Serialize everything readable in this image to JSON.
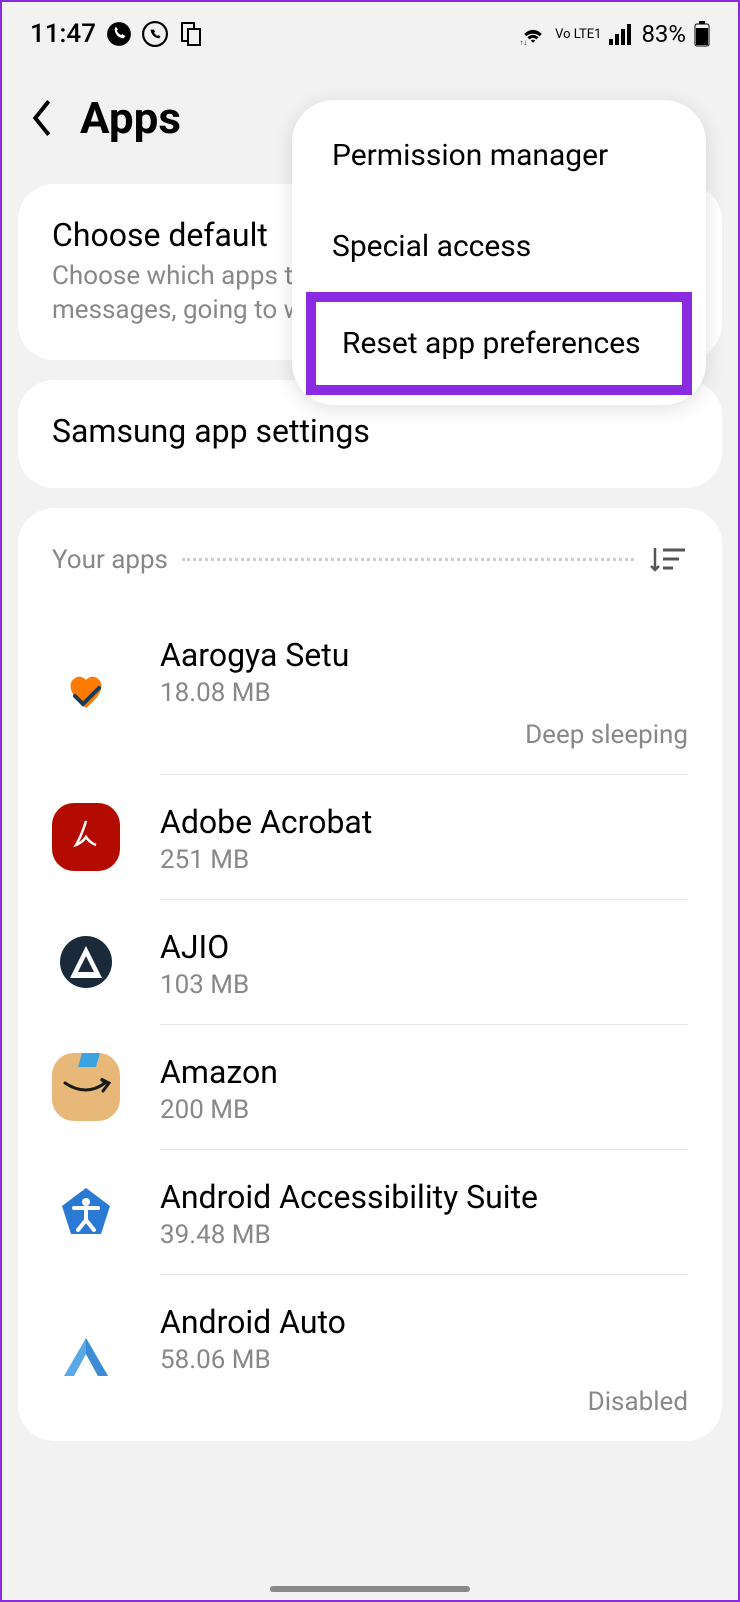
{
  "status": {
    "time": "11:47",
    "battery": "83%",
    "network": "Vo LTE1"
  },
  "header": {
    "title": "Apps"
  },
  "defaultCard": {
    "title": "Choose default",
    "subtitle": "Choose which apps to use for making calls, sending messages, going to websites, and more."
  },
  "samsungCard": {
    "title": "Samsung app settings"
  },
  "appsSection": {
    "label": "Your apps"
  },
  "apps": [
    {
      "name": "Aarogya Setu",
      "size": "18.08 MB",
      "status": "Deep sleeping"
    },
    {
      "name": "Adobe Acrobat",
      "size": "251 MB",
      "status": ""
    },
    {
      "name": "AJIO",
      "size": "103 MB",
      "status": ""
    },
    {
      "name": "Amazon",
      "size": "200 MB",
      "status": ""
    },
    {
      "name": "Android Accessibility Suite",
      "size": "39.48 MB",
      "status": ""
    },
    {
      "name": "Android Auto",
      "size": "58.06 MB",
      "status": "Disabled"
    }
  ],
  "popup": {
    "items": [
      "Permission manager",
      "Special access",
      "Reset app preferences"
    ]
  }
}
